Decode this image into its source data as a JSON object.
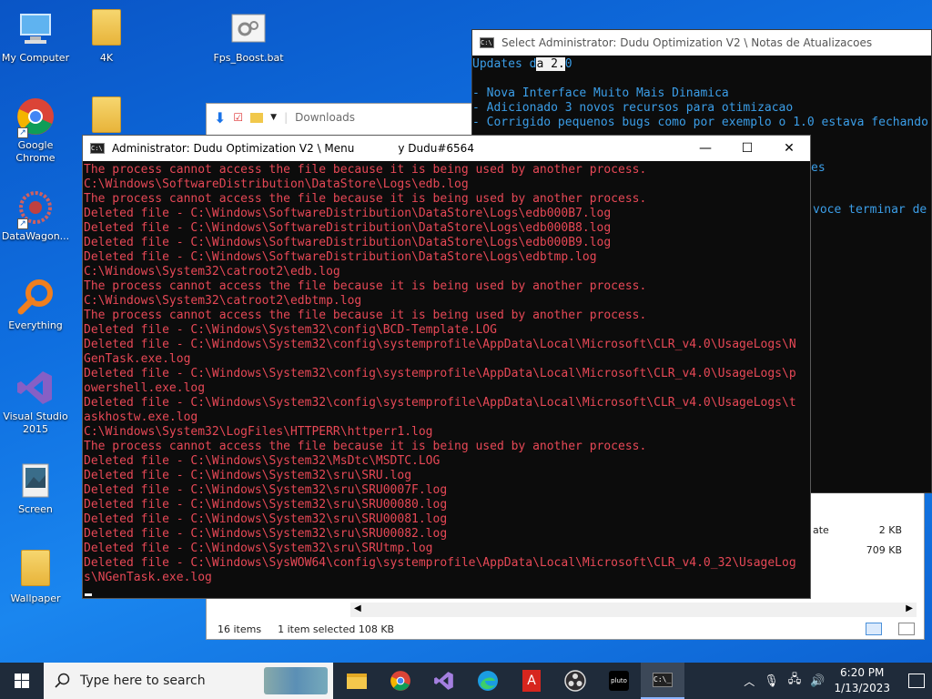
{
  "desktop_icons": [
    {
      "label": "My Computer"
    },
    {
      "label": "4K"
    },
    {
      "label": "Fps_Boost.bat"
    },
    {
      "label": "Google Chrome"
    },
    {
      "label": "DataWagon..."
    },
    {
      "label": "Everything"
    },
    {
      "label": "Visual Studio 2015"
    },
    {
      "label": "Screen"
    },
    {
      "label": "Wallpaper"
    }
  ],
  "explorer": {
    "qat_path": "Downloads",
    "status_items": "16 items",
    "status_selected": "1 item selected  108 KB",
    "rows": [
      {
        "name_tail": "ate",
        "size": "2 KB"
      },
      {
        "name_tail": "",
        "size": "709 KB"
      }
    ]
  },
  "console_updates": {
    "title": "Select Administrator:  Dudu Optimization V2 \\ Notas de Atualizacoes",
    "line1_pre": "Updates d",
    "line1_sel": "a 2.",
    "line1_post": "0",
    "lines": [
      "",
      "- Nova Interface Muito Mais Dinamica",
      "- Adicionado 3 novos recursos para otimizacao",
      "- Corrigido pequenos bugs como por exemplo o 1.0 estava fechando"
    ],
    "fragment1": "es",
    "fragment2": "voce terminar de"
  },
  "console_main": {
    "title": "Administrator:  Dudu Optimization V2 \\ Menu",
    "title_extra": "y Dudu#6564",
    "minimize": "—",
    "maximize": "☐",
    "close": "✕",
    "lines": [
      "The process cannot access the file because it is being used by another process.",
      "C:\\Windows\\SoftwareDistribution\\DataStore\\Logs\\edb.log",
      "The process cannot access the file because it is being used by another process.",
      "Deleted file - C:\\Windows\\SoftwareDistribution\\DataStore\\Logs\\edb000B7.log",
      "Deleted file - C:\\Windows\\SoftwareDistribution\\DataStore\\Logs\\edb000B8.log",
      "Deleted file - C:\\Windows\\SoftwareDistribution\\DataStore\\Logs\\edb000B9.log",
      "Deleted file - C:\\Windows\\SoftwareDistribution\\DataStore\\Logs\\edbtmp.log",
      "C:\\Windows\\System32\\catroot2\\edb.log",
      "The process cannot access the file because it is being used by another process.",
      "C:\\Windows\\System32\\catroot2\\edbtmp.log",
      "The process cannot access the file because it is being used by another process.",
      "Deleted file - C:\\Windows\\System32\\config\\BCD-Template.LOG",
      "Deleted file - C:\\Windows\\System32\\config\\systemprofile\\AppData\\Local\\Microsoft\\CLR_v4.0\\UsageLogs\\N",
      "GenTask.exe.log",
      "Deleted file - C:\\Windows\\System32\\config\\systemprofile\\AppData\\Local\\Microsoft\\CLR_v4.0\\UsageLogs\\p",
      "owershell.exe.log",
      "Deleted file - C:\\Windows\\System32\\config\\systemprofile\\AppData\\Local\\Microsoft\\CLR_v4.0\\UsageLogs\\t",
      "askhostw.exe.log",
      "C:\\Windows\\System32\\LogFiles\\HTTPERR\\httperr1.log",
      "The process cannot access the file because it is being used by another process.",
      "Deleted file - C:\\Windows\\System32\\MsDtc\\MSDTC.LOG",
      "Deleted file - C:\\Windows\\System32\\sru\\SRU.log",
      "Deleted file - C:\\Windows\\System32\\sru\\SRU0007F.log",
      "Deleted file - C:\\Windows\\System32\\sru\\SRU00080.log",
      "Deleted file - C:\\Windows\\System32\\sru\\SRU00081.log",
      "Deleted file - C:\\Windows\\System32\\sru\\SRU00082.log",
      "Deleted file - C:\\Windows\\System32\\sru\\SRUtmp.log",
      "Deleted file - C:\\Windows\\SysWOW64\\config\\systemprofile\\AppData\\Local\\Microsoft\\CLR_v4.0_32\\UsageLog",
      "s\\NGenTask.exe.log"
    ]
  },
  "taskbar": {
    "search_placeholder": "Type here to search",
    "time": "6:20 PM",
    "date": "1/13/2023",
    "apps": [
      "file-explorer",
      "chrome",
      "visual-studio",
      "edge",
      "acrobat",
      "obs",
      "pluto-tv",
      "command-prompt"
    ]
  },
  "colors": {
    "console_text_main": "#e74856",
    "console_text_updates": "#3b9ee8",
    "taskbar_bg": "#1f2b3a"
  }
}
